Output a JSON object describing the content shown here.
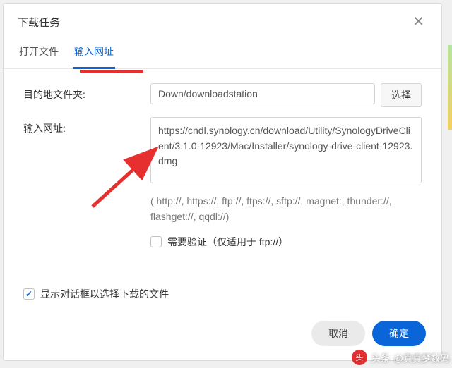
{
  "dialog": {
    "title": "下载任务"
  },
  "tabs": {
    "open_file": "打开文件",
    "enter_url": "输入网址"
  },
  "form": {
    "dest_label": "目的地文件夹:",
    "dest_value": "Down/downloadstation",
    "select_btn": "选择",
    "url_label": "输入网址:",
    "url_value": "https://cndl.synology.cn/download/Utility/SynologyDriveClient/3.1.0-12923/Mac/Installer/synology-drive-client-12923.dmg",
    "protocols_hint": "( http://, https://, ftp://, ftps://, sftp://, magnet:, thunder://, flashget://, qqdl://)",
    "need_auth_label": "需要验证（仅适用于 ftp://）",
    "show_dialog_label": "显示对话框以选择下载的文件"
  },
  "buttons": {
    "cancel": "取消",
    "ok": "确定"
  },
  "attribution": {
    "prefix": "头条",
    "name": "@真真梦数码"
  }
}
